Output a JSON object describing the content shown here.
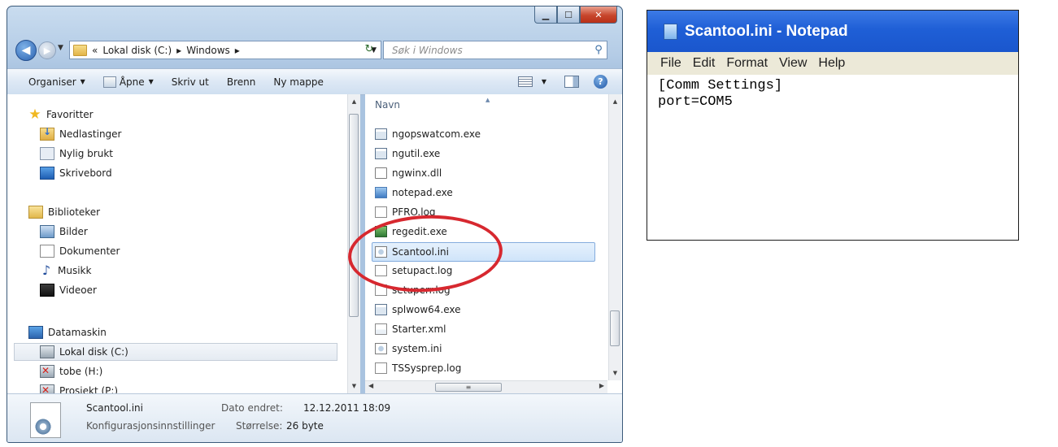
{
  "explorer": {
    "address": {
      "crumb_prefix": "«",
      "crumbs": [
        "Lokal disk (C:)",
        "Windows"
      ],
      "separator": "▸"
    },
    "search": {
      "placeholder": "Søk i Windows"
    },
    "toolbar": {
      "organize": "Organiser",
      "open": "Åpne",
      "print": "Skriv ut",
      "burn": "Brenn",
      "new_folder": "Ny mappe"
    },
    "nav": {
      "items": [
        {
          "label": "Favoritter",
          "icon": "star-icon"
        },
        {
          "label": "Nedlastinger",
          "icon": "downloads-folder-icon"
        },
        {
          "label": "Nylig brukt",
          "icon": "recent-places-icon"
        },
        {
          "label": "Skrivebord",
          "icon": "desktop-icon"
        },
        {
          "label": "Biblioteker",
          "icon": "libraries-icon"
        },
        {
          "label": "Bilder",
          "icon": "pictures-icon"
        },
        {
          "label": "Dokumenter",
          "icon": "documents-icon"
        },
        {
          "label": "Musikk",
          "icon": "music-icon"
        },
        {
          "label": "Videoer",
          "icon": "videos-icon"
        },
        {
          "label": "Datamaskin",
          "icon": "computer-icon"
        },
        {
          "label": "Lokal disk (C:)",
          "icon": "drive-icon",
          "selected": true
        },
        {
          "label": "tobe (H:)",
          "icon": "network-drive-disconnected-icon"
        },
        {
          "label": "Prosjekt (P:)",
          "icon": "network-drive-disconnected-icon"
        }
      ]
    },
    "files": {
      "column_header": "Navn",
      "items": [
        {
          "name": "ngopswatcom.exe",
          "type": "exe"
        },
        {
          "name": "ngutil.exe",
          "type": "exe"
        },
        {
          "name": "ngwinx.dll",
          "type": "dll"
        },
        {
          "name": "notepad.exe",
          "type": "notepad"
        },
        {
          "name": "PFRO.log",
          "type": "log"
        },
        {
          "name": "regedit.exe",
          "type": "regedit"
        },
        {
          "name": "Scantool.ini",
          "type": "ini",
          "selected": true
        },
        {
          "name": "setupact.log",
          "type": "log"
        },
        {
          "name": "setuperr.log",
          "type": "log"
        },
        {
          "name": "splwow64.exe",
          "type": "exe"
        },
        {
          "name": "Starter.xml",
          "type": "xml"
        },
        {
          "name": "system.ini",
          "type": "ini"
        },
        {
          "name": "TSSysprep.log",
          "type": "log"
        }
      ]
    },
    "details": {
      "name": "Scantool.ini",
      "type": "Konfigurasjonsinnstillinger",
      "modified_label": "Dato endret:",
      "modified_value": "12.12.2011 18:09",
      "size_label": "Størrelse:",
      "size_value": "26 byte"
    },
    "annotation_color": "#d7282f"
  },
  "notepad": {
    "title": "Scantool.ini - Notepad",
    "menu": [
      "File",
      "Edit",
      "Format",
      "View",
      "Help"
    ],
    "content": "[Comm Settings]\nport=COM5"
  }
}
